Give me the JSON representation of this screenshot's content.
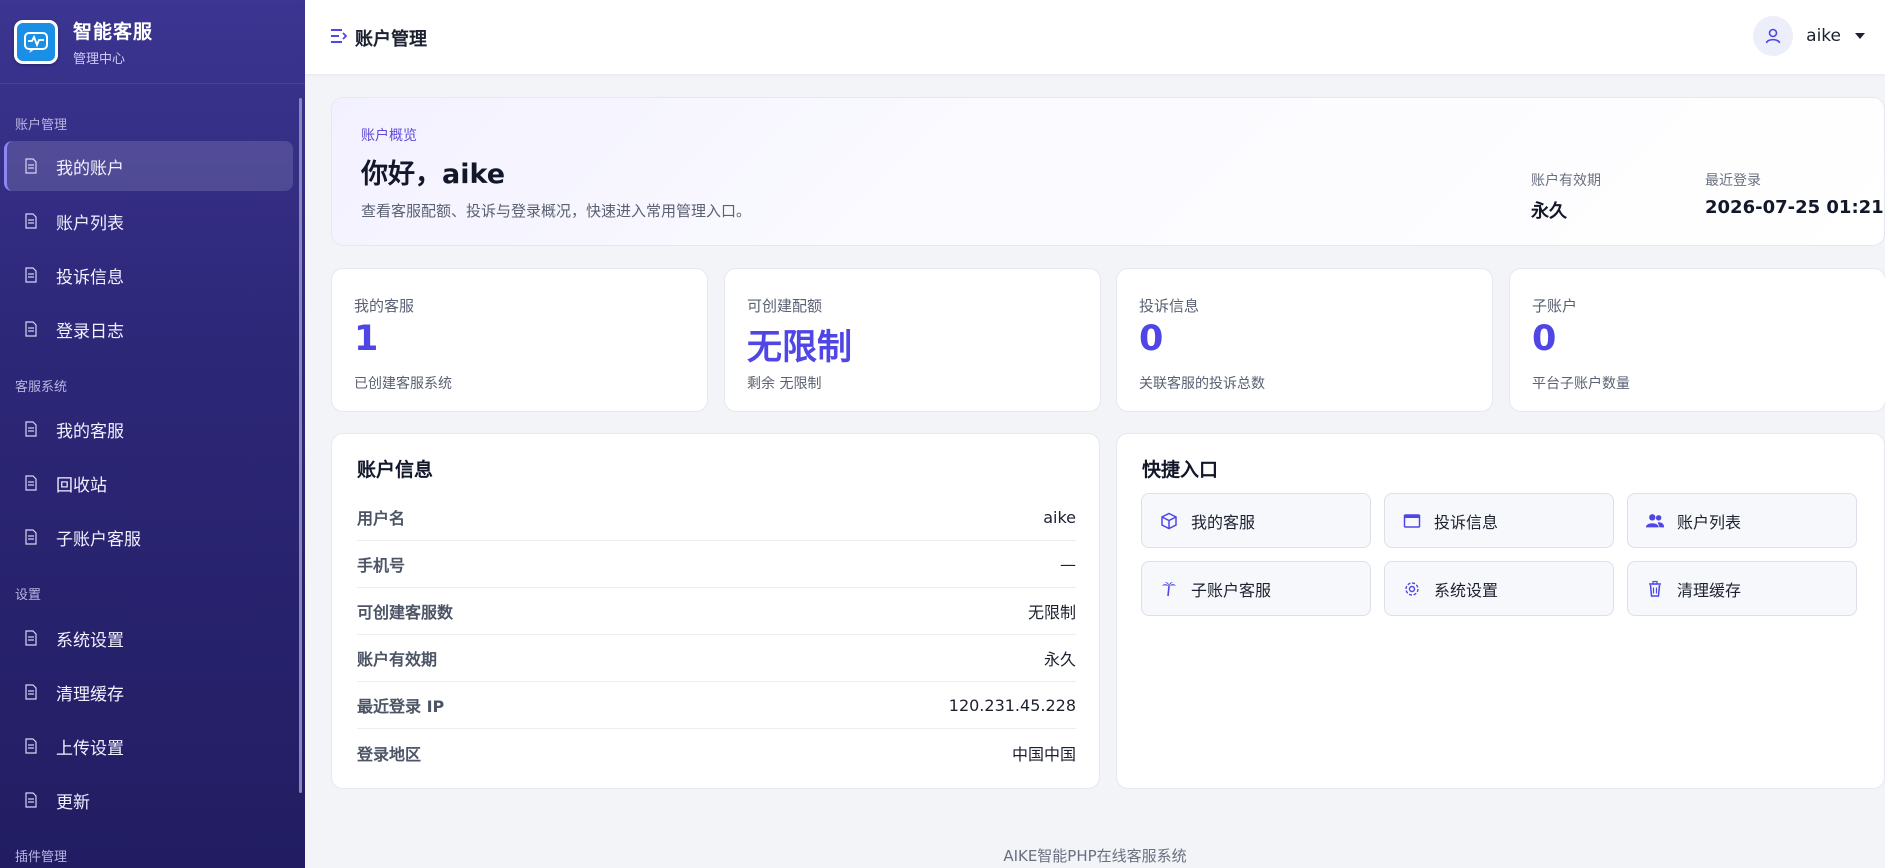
{
  "brand": {
    "title": "智能客服",
    "subtitle": "管理中心"
  },
  "sidebar": {
    "sections": [
      {
        "label": "账户管理",
        "items": [
          {
            "label": "我的账户",
            "active": true
          },
          {
            "label": "账户列表"
          },
          {
            "label": "投诉信息"
          },
          {
            "label": "登录日志"
          }
        ]
      },
      {
        "label": "客服系统",
        "items": [
          {
            "label": "我的客服"
          },
          {
            "label": "回收站"
          },
          {
            "label": "子账户客服"
          }
        ]
      },
      {
        "label": "设置",
        "items": [
          {
            "label": "系统设置"
          },
          {
            "label": "清理缓存"
          },
          {
            "label": "上传设置"
          },
          {
            "label": "更新"
          }
        ]
      },
      {
        "label": "插件管理",
        "items": []
      }
    ]
  },
  "header": {
    "title": "账户管理",
    "username": "aike"
  },
  "hero": {
    "eyebrow": "账户概览",
    "title": "你好，aike",
    "description": "查看客服配额、投诉与登录概况，快速进入常用管理入口。",
    "validity_label": "账户有效期",
    "validity_value": "永久",
    "last_login_label": "最近登录",
    "last_login_value": "2026-07-25 01:21"
  },
  "stats": [
    {
      "label": "我的客服",
      "value": "1",
      "note": "已创建客服系统"
    },
    {
      "label": "可创建配额",
      "value": "无限制",
      "note": "剩余 无限制"
    },
    {
      "label": "投诉信息",
      "value": "0",
      "note": "关联客服的投诉总数"
    },
    {
      "label": "子账户",
      "value": "0",
      "note": "平台子账户数量"
    }
  ],
  "account_info": {
    "title": "账户信息",
    "rows": [
      {
        "key": "用户名",
        "value": "aike"
      },
      {
        "key": "手机号",
        "value": "—"
      },
      {
        "key": "可创建客服数",
        "value": "无限制"
      },
      {
        "key": "账户有效期",
        "value": "永久"
      },
      {
        "key": "最近登录 IP",
        "value": "120.231.45.228"
      },
      {
        "key": "登录地区",
        "value": "中国中国"
      }
    ]
  },
  "quick_links": {
    "title": "快捷入口",
    "items": [
      {
        "label": "我的客服",
        "icon": "cube-icon"
      },
      {
        "label": "投诉信息",
        "icon": "window-icon"
      },
      {
        "label": "账户列表",
        "icon": "users-icon"
      },
      {
        "label": "子账户客服",
        "icon": "palm-tree-icon"
      },
      {
        "label": "系统设置",
        "icon": "gear-icon"
      },
      {
        "label": "清理缓存",
        "icon": "trash-icon"
      }
    ]
  },
  "footer": {
    "text": "AIKE智能PHP在线客服系统"
  },
  "colors": {
    "accent": "#4f46e5",
    "sidebar": "#2d2778"
  }
}
